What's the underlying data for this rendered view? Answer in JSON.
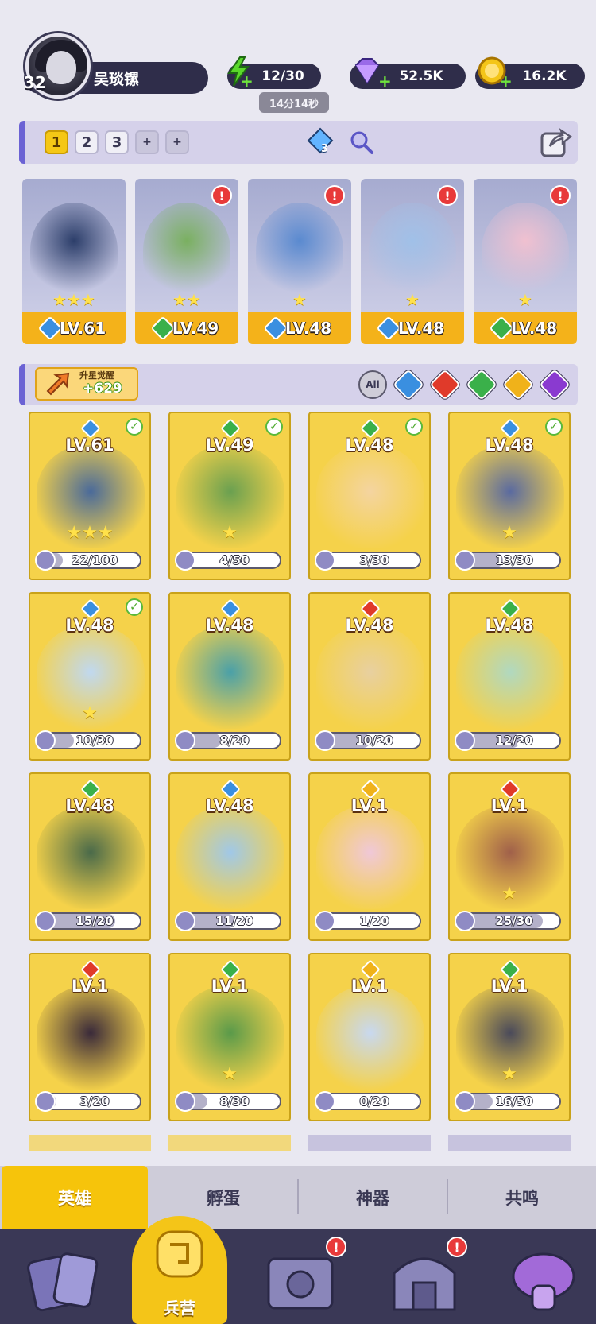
{
  "player": {
    "level": "32",
    "name": "吴琰镙"
  },
  "resources": {
    "energy": "12/30",
    "energy_timer": "14分14秒",
    "gems": "52.5K",
    "gold": "16.2K"
  },
  "team": {
    "slots": [
      "1",
      "2",
      "3",
      "+",
      "+"
    ],
    "active_slot": "1",
    "badge_count": "3"
  },
  "team_heroes": [
    {
      "level": "LV.61",
      "element": "water",
      "stars": "★★★",
      "alert": false
    },
    {
      "level": "LV.49",
      "element": "nature",
      "stars": "★★",
      "alert": true
    },
    {
      "level": "LV.48",
      "element": "water",
      "stars": "★",
      "alert": true
    },
    {
      "level": "LV.48",
      "element": "water",
      "stars": "★",
      "alert": true
    },
    {
      "level": "LV.48",
      "element": "nature",
      "stars": "★",
      "alert": true
    }
  ],
  "awaken": {
    "title": "升星觉醒",
    "value": "+629"
  },
  "filters": {
    "all_label": "All",
    "elements": [
      "water",
      "fire",
      "nature",
      "light",
      "dark"
    ]
  },
  "heroes": [
    {
      "level": "LV.61",
      "element": "water",
      "progress": "22/100",
      "stars": "★★★",
      "checked": true
    },
    {
      "level": "LV.49",
      "element": "nature",
      "progress": "4/50",
      "stars": "★",
      "checked": true
    },
    {
      "level": "LV.48",
      "element": "nature",
      "progress": "3/30",
      "stars": "",
      "checked": true
    },
    {
      "level": "LV.48",
      "element": "water",
      "progress": "13/30",
      "stars": "★",
      "checked": true
    },
    {
      "level": "LV.48",
      "element": "water",
      "progress": "10/30",
      "stars": "★",
      "checked": true
    },
    {
      "level": "LV.48",
      "element": "water",
      "progress": "8/20",
      "stars": "",
      "checked": false
    },
    {
      "level": "LV.48",
      "element": "fire",
      "progress": "10/20",
      "stars": "",
      "checked": false
    },
    {
      "level": "LV.48",
      "element": "nature",
      "progress": "12/20",
      "stars": "",
      "checked": false
    },
    {
      "level": "LV.48",
      "element": "nature",
      "progress": "15/20",
      "stars": "",
      "checked": false
    },
    {
      "level": "LV.48",
      "element": "water",
      "progress": "11/20",
      "stars": "",
      "checked": false
    },
    {
      "level": "LV.1",
      "element": "light",
      "progress": "1/20",
      "stars": "",
      "checked": false
    },
    {
      "level": "LV.1",
      "element": "fire",
      "progress": "25/30",
      "stars": "★",
      "checked": false
    },
    {
      "level": "LV.1",
      "element": "fire",
      "progress": "3/20",
      "stars": "",
      "checked": false
    },
    {
      "level": "LV.1",
      "element": "nature",
      "progress": "8/30",
      "stars": "★",
      "checked": false
    },
    {
      "level": "LV.1",
      "element": "light",
      "progress": "0/20",
      "stars": "",
      "checked": false
    },
    {
      "level": "LV.1",
      "element": "nature",
      "progress": "16/50",
      "stars": "★",
      "checked": false
    }
  ],
  "tabs": [
    "英雄",
    "孵蛋",
    "神器",
    "共鸣"
  ],
  "nav": {
    "active_label": "兵营"
  },
  "colors": {
    "water": "#3a8fe0",
    "fire": "#e03a2a",
    "nature": "#3ab04a",
    "light": "#f0b21a",
    "dark": "#8a3ad0",
    "accent": "#f4c518",
    "panel": "#2f2d4a"
  }
}
